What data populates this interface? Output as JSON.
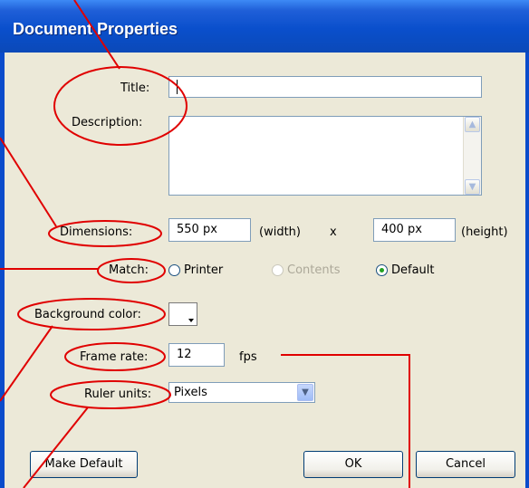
{
  "dialog": {
    "title": "Document Properties"
  },
  "fields": {
    "title_label": "Title:",
    "description_label": "Description:",
    "dimensions_label": "Dimensions:",
    "width_value": "550 px",
    "width_unit": "(width)",
    "x_separator": "x",
    "height_value": "400 px",
    "height_unit": "(height)",
    "match_label": "Match:",
    "match_options": [
      {
        "label": "Printer",
        "selected": false,
        "enabled": true
      },
      {
        "label": "Contents",
        "selected": false,
        "enabled": false
      },
      {
        "label": "Default",
        "selected": true,
        "enabled": true
      }
    ],
    "background_color_label": "Background color:",
    "background_color_value": "#ffffff",
    "frame_rate_label": "Frame rate:",
    "frame_rate_value": "12",
    "frame_rate_unit": "fps",
    "ruler_units_label": "Ruler units:",
    "ruler_units_value": "Pixels"
  },
  "buttons": {
    "make_default": "Make Default",
    "ok": "OK",
    "cancel": "Cancel"
  },
  "colors": {
    "titlebar": "#0a4fcc",
    "dialog_bg": "#ece9d8",
    "annotation": "#e00000"
  }
}
